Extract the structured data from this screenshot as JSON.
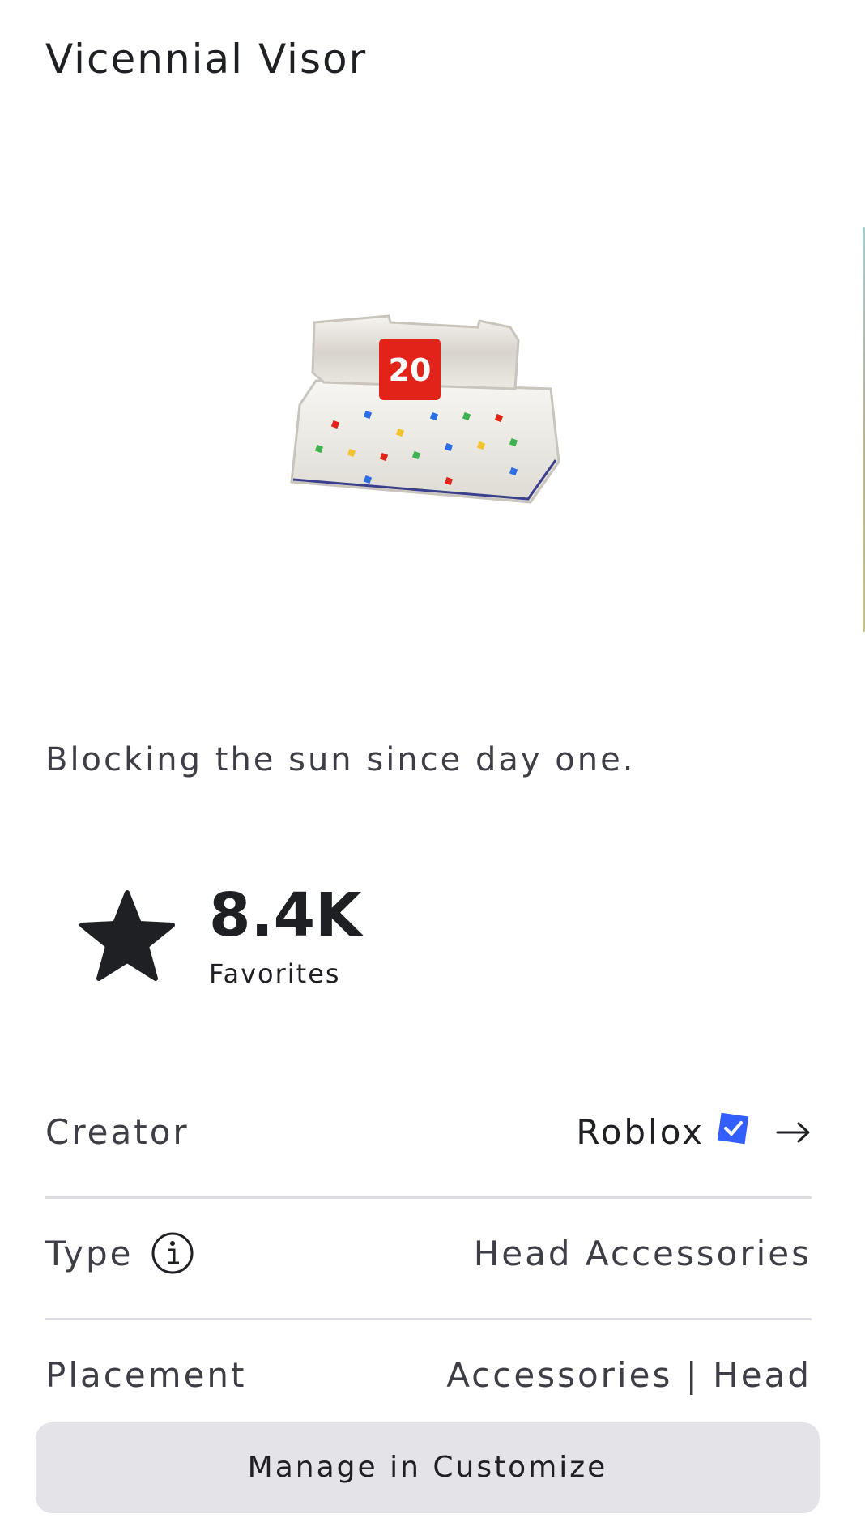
{
  "item": {
    "title": "Vicennial Visor",
    "description": "Blocking the sun since day one.",
    "image_icon": "visor-image",
    "badge_text": "20"
  },
  "favorites": {
    "count": "8.4K",
    "label": "Favorites",
    "icon": "star-icon"
  },
  "details": {
    "creator": {
      "label": "Creator",
      "value": "Roblox",
      "verified_icon": "verified-badge-icon",
      "arrow_icon": "arrow-right-icon"
    },
    "type": {
      "label": "Type",
      "value": "Head Accessories",
      "info_icon": "info-icon"
    },
    "placement": {
      "label": "Placement",
      "value": "Accessories | Head"
    }
  },
  "actions": {
    "manage_label": "Manage in Customize"
  },
  "colors": {
    "text": "#1f2024",
    "muted_text": "#3e3f46",
    "divider": "#dcdde2",
    "button_bg": "#e4e4e8",
    "verified_blue": "#335fff",
    "badge_red": "#e2231a"
  }
}
